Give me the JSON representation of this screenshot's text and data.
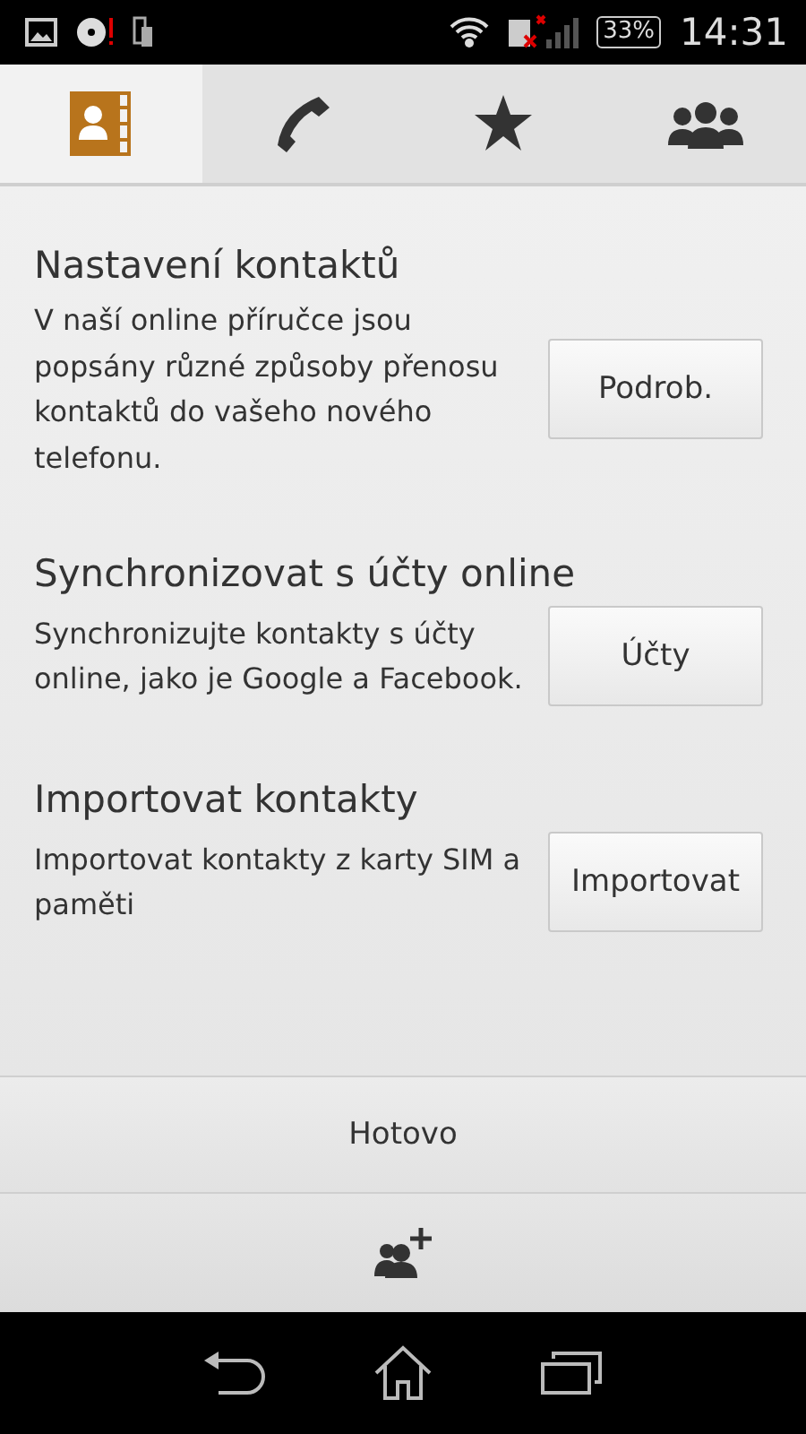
{
  "status_bar": {
    "battery": "33%",
    "time": "14:31"
  },
  "tabs": [
    {
      "kind": "contacts",
      "selected": true
    },
    {
      "kind": "phone",
      "selected": false
    },
    {
      "kind": "favorites",
      "selected": false
    },
    {
      "kind": "groups",
      "selected": false
    }
  ],
  "sections": [
    {
      "title": "Nastavení kontaktů",
      "description": "V naší online příručce jsou popsány různé způsoby přenosu kontaktů do vašeho nového telefonu.",
      "button": "Podrob."
    },
    {
      "title": "Synchronizovat s účty online",
      "description": "Synchronizujte kontakty s účty online, jako je Google a Facebook.",
      "button": "Účty"
    },
    {
      "title": "Importovat kontakty",
      "description": "Importovat kontakty z karty SIM a paměti",
      "button": "Importovat"
    }
  ],
  "done_button": "Hotovo"
}
